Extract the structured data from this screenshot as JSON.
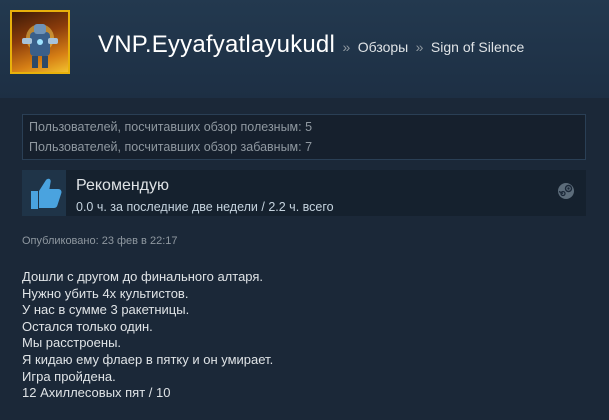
{
  "header": {
    "username": "VNP.Eyyafyatlayukudl",
    "separator": "»",
    "breadcrumb_reviews": "Обзоры",
    "breadcrumb_game": "Sign of Silence"
  },
  "helpful": {
    "helpful_text": "Пользователей, посчитавших обзор полезным: 5",
    "funny_text": "Пользователей, посчитавших обзор забавным: 7"
  },
  "recommendation": {
    "title": "Рекомендую",
    "hours": "0.0 ч. за последние две недели / 2.2 ч. всего",
    "thumb_icon": "thumbs-up-icon",
    "platform_icon": "steam-icon"
  },
  "posted": "Опубликовано: 23 фев в 22:17",
  "review_lines": [
    "Дошли с другом до финального алтаря.",
    "Нужно убить 4х культистов.",
    "У нас в сумме 3 ракетницы.",
    "Остался только один.",
    "Мы расстроены.",
    "Я кидаю ему флаер в пятку и он умирает.",
    "Игра пройдена.",
    "12 Ахиллесовых пят / 10"
  ],
  "colors": {
    "background": "#1b2838",
    "avatar_border": "#e8b10b",
    "thumb_blue": "#4aa3df"
  }
}
